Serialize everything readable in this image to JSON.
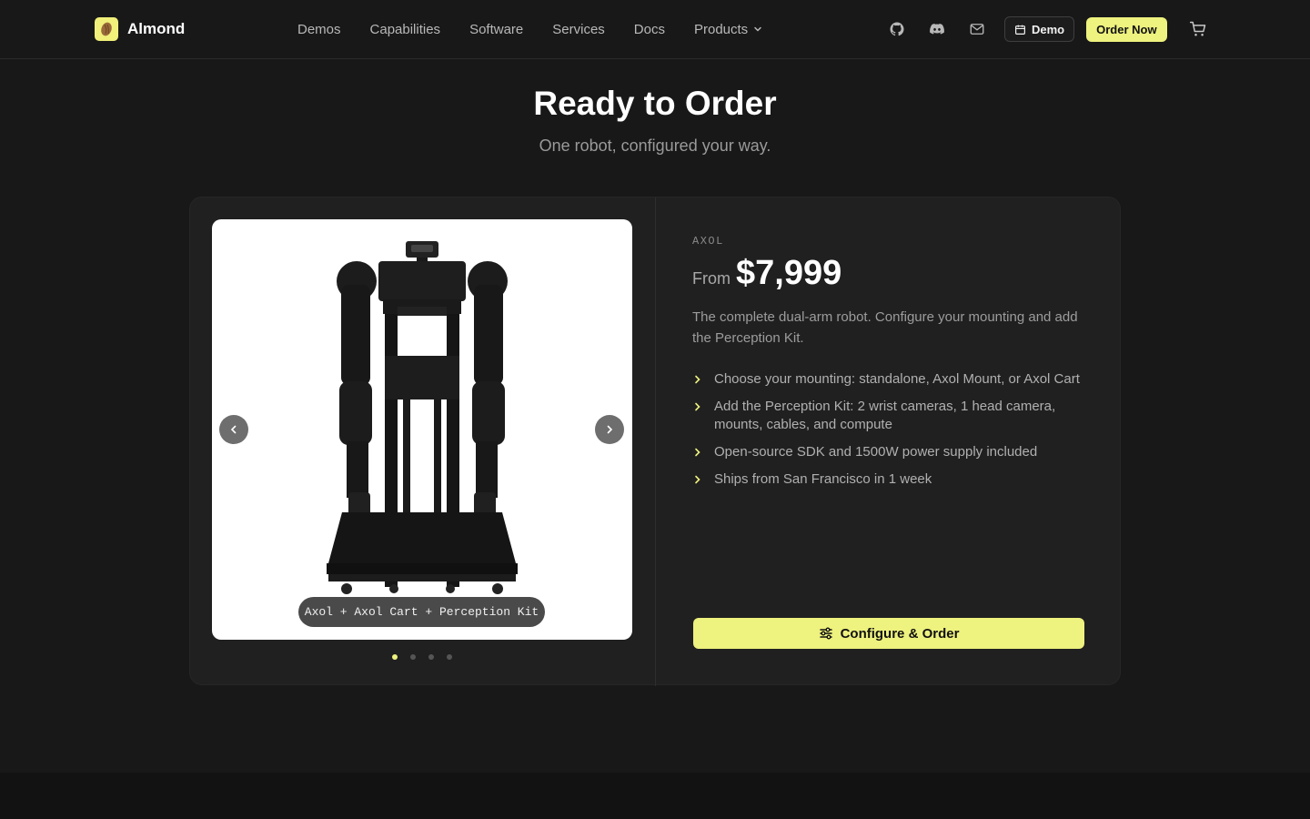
{
  "nav": {
    "brand": "Almond",
    "links": [
      {
        "label": "Demos"
      },
      {
        "label": "Capabilities"
      },
      {
        "label": "Software"
      },
      {
        "label": "Services"
      },
      {
        "label": "Docs"
      },
      {
        "label": "Products"
      }
    ],
    "icons": [
      "github-icon",
      "discord-icon",
      "mail-icon"
    ],
    "demo_label": "Demo",
    "order_label": "Order Now"
  },
  "hero": {
    "title": "Ready to Order",
    "subtitle": "One robot, configured your way."
  },
  "product": {
    "eyebrow": "AXOL",
    "price_prefix": "From",
    "price": "$7,999",
    "description": "The complete dual-arm robot. Configure your mounting and add the Perception Kit.",
    "features": [
      "Choose your mounting: standalone, Axol Mount, or Axol Cart",
      "Add the Perception Kit: 2 wrist cameras, 1 head camera, mounts, cables, and compute",
      "Open-source SDK and 1500W power supply included",
      "Ships from San Francisco in 1 week"
    ],
    "cta_label": "Configure & Order"
  },
  "gallery": {
    "caption": "Axol + Axol Cart + Perception Kit",
    "slide_count": 4,
    "active_slide": 1
  },
  "colors": {
    "accent": "#eef27e",
    "background": "#181818",
    "card": "#202020"
  }
}
